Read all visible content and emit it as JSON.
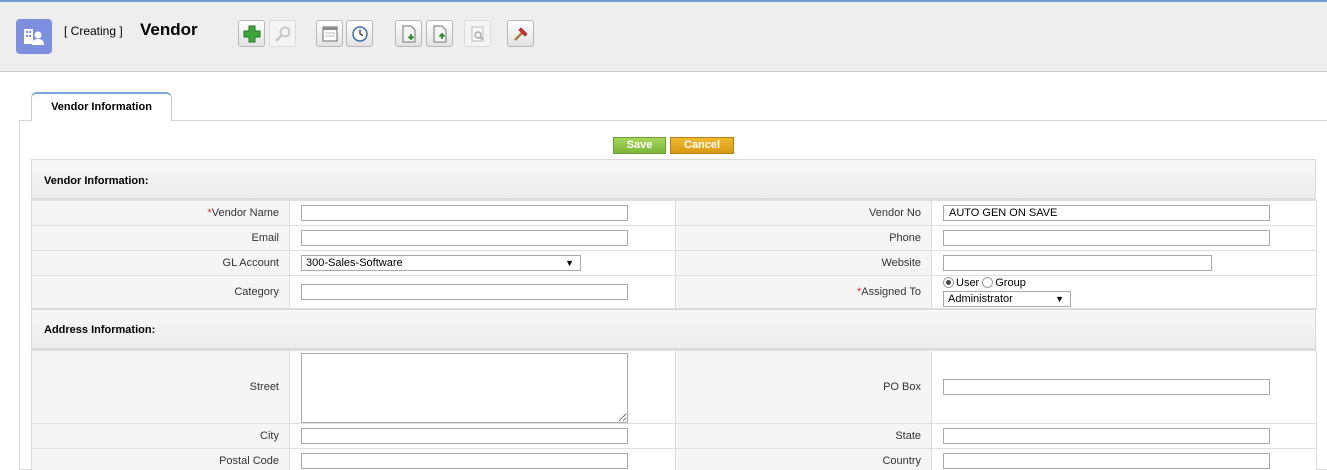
{
  "header": {
    "mode": "[ Creating ]",
    "title": "Vendor"
  },
  "toolbar": [
    {
      "name": "create-icon"
    },
    {
      "name": "search-icon"
    },
    {
      "name": "calendar-icon"
    },
    {
      "name": "clock-icon"
    },
    {
      "name": "import-icon"
    },
    {
      "name": "export-icon"
    },
    {
      "name": "find-duplicates-icon"
    },
    {
      "name": "settings-icon"
    }
  ],
  "tab": {
    "label": "Vendor Information"
  },
  "actions": {
    "save": "Save",
    "cancel": "Cancel"
  },
  "vendor_section": {
    "title": "Vendor Information:",
    "vendor_name": {
      "label": "Vendor Name",
      "value": ""
    },
    "vendor_no": {
      "label": "Vendor No",
      "value": "AUTO GEN ON SAVE"
    },
    "email": {
      "label": "Email",
      "value": ""
    },
    "phone": {
      "label": "Phone",
      "value": ""
    },
    "gl_account": {
      "label": "GL Account",
      "value": "300-Sales-Software"
    },
    "website": {
      "label": "Website",
      "value": ""
    },
    "category": {
      "label": "Category",
      "value": ""
    },
    "assigned_to": {
      "label": "Assigned To",
      "user_option": "User",
      "group_option": "Group",
      "value": "Administrator"
    }
  },
  "address_section": {
    "title": "Address Information:",
    "street": {
      "label": "Street",
      "value": ""
    },
    "po_box": {
      "label": "PO Box",
      "value": ""
    },
    "city": {
      "label": "City",
      "value": ""
    },
    "state": {
      "label": "State",
      "value": ""
    },
    "postal_code": {
      "label": "Postal Code",
      "value": ""
    },
    "country": {
      "label": "Country",
      "value": ""
    }
  },
  "required_marker": "*"
}
